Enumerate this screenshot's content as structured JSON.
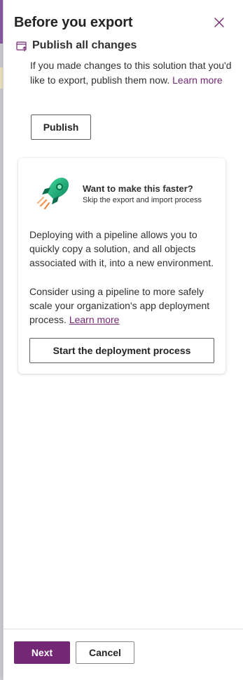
{
  "panel": {
    "title": "Before you export",
    "close_icon": "close-icon"
  },
  "publish_section": {
    "icon": "publish-icon",
    "title": "Publish all changes",
    "description": "If you made changes to this solution that you'd like to export, publish them now.",
    "learn_more": "Learn more",
    "publish_label": "Publish"
  },
  "pipeline_card": {
    "icon": "rocket-icon",
    "title": "Want to make this faster?",
    "subtitle": "Skip the export and import process",
    "paragraph1": "Deploying with a pipeline allows you to quickly copy a solution, and all objects associated with it, into a new environment.",
    "paragraph2": "Consider using a pipeline to more safely scale your organization's app deployment process.",
    "learn_more": "Learn more",
    "deploy_label": "Start the deployment process"
  },
  "footer": {
    "next_label": "Next",
    "cancel_label": "Cancel"
  },
  "colors": {
    "accent": "#742774",
    "link": "#742774"
  }
}
